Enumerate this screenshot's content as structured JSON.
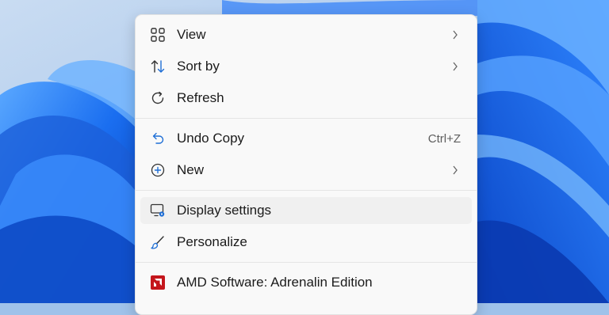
{
  "context_menu": {
    "items": [
      {
        "label": "View",
        "icon": "grid-icon",
        "submenu": true
      },
      {
        "label": "Sort by",
        "icon": "sort-arrows-icon",
        "submenu": true
      },
      {
        "label": "Refresh",
        "icon": "refresh-icon",
        "submenu": false
      },
      {
        "label": "Undo Copy",
        "icon": "undo-icon",
        "shortcut": "Ctrl+Z"
      },
      {
        "label": "New",
        "icon": "plus-circle-icon",
        "submenu": true
      },
      {
        "label": "Display settings",
        "icon": "display-settings-icon",
        "hovered": true
      },
      {
        "label": "Personalize",
        "icon": "brush-icon"
      },
      {
        "label": "AMD Software: Adrenalin Edition",
        "icon": "amd-logo-icon"
      }
    ]
  },
  "colors": {
    "menu_bg": "#f9f9f9",
    "hover_bg": "#f0f0f0",
    "accent_blue": "#1f6fd6",
    "amd_red": "#c4161c"
  }
}
